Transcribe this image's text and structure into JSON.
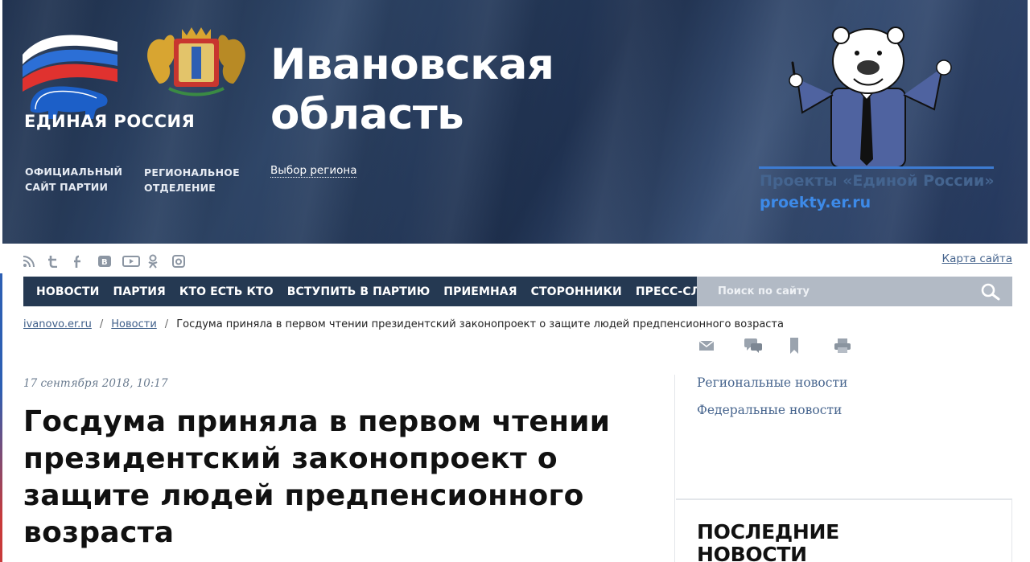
{
  "header": {
    "party_logo_text": "ЕДИНАЯ РОССИЯ",
    "official_site_label": "ОФИЦИАЛЬНЫЙ САЙТ ПАРТИИ",
    "regional_branch_label": "РЕГИОНАЛЬНОЕ ОТДЕЛЕНИЕ",
    "region_title": "Ивановская область",
    "region_select_label": "Выбор региона",
    "projects_title": "Проекты «Единой России»",
    "projects_link": "proekty.er.ru"
  },
  "social": [
    "rss-icon",
    "twitter-icon",
    "facebook-icon",
    "vk-icon",
    "youtube-icon",
    "odnoklassniki-icon",
    "instagram-icon"
  ],
  "sitemap_label": "Карта сайта",
  "nav": {
    "items": [
      "НОВОСТИ",
      "ПАРТИЯ",
      "КТО ЕСТЬ КТО",
      "ВСТУПИТЬ В ПАРТИЮ",
      "ПРИЕМНАЯ",
      "СТОРОННИКИ",
      "ПРЕСС-СЛУЖБА"
    ],
    "search_placeholder": "Поиск по сайту"
  },
  "breadcrumb": {
    "home": "ivanovo.er.ru",
    "section": "Новости",
    "current": "Госдума приняла в первом чтении президентский законопроект о защите людей предпенсионного возраста"
  },
  "article": {
    "date": "17 сентября 2018, 10:17",
    "title": "Госдума приняла в первом чтении президентский законопроект о защите людей предпенсионного возраста"
  },
  "sidebar": {
    "links": [
      "Региональные новости",
      "Федеральные новости"
    ],
    "latest_title": "ПОСЛЕДНИЕ НОВОСТИ"
  },
  "colors": {
    "nav_bg": "#253952",
    "search_bg": "#b2bac5",
    "link": "#47658e",
    "projects_blue": "#3d8ae8"
  }
}
